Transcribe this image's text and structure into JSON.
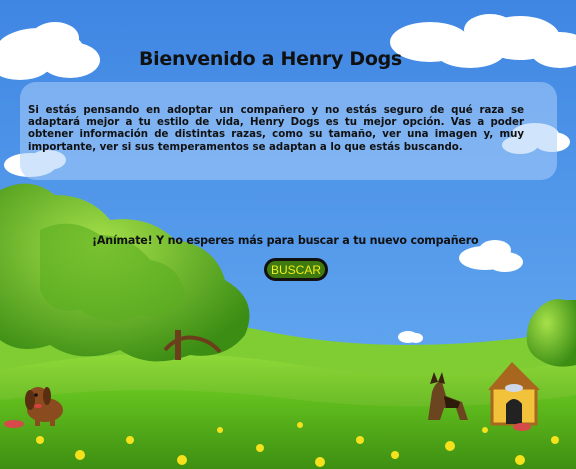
{
  "header": {
    "title": "Bienvenido a Henry Dogs"
  },
  "intro": {
    "text": "Si estás pensando en adoptar un compañero y no estás seguro de qué raza se adaptará mejor a tu estilo de vida, Henry Dogs es tu mejor opción. Vas a poder obtener información de distintas razas, como su tamaño, ver una imagen y, muy importante, ver si sus temperamentos se adaptan a lo que estás buscando."
  },
  "cta": {
    "text": "¡Anímate! Y no esperes más para buscar a tu nuevo compañero"
  },
  "search_button": {
    "label": "BUSCAR"
  },
  "colors": {
    "sky": "#4a8fe6",
    "grass": "#5cbb1f",
    "button_bg": "#3f7a10",
    "button_text": "#f0f01a"
  },
  "illustrations": [
    "cloud-icon",
    "tree-icon",
    "dog-icon",
    "doghouse-icon",
    "flower-icon",
    "dog-bowl-icon"
  ]
}
